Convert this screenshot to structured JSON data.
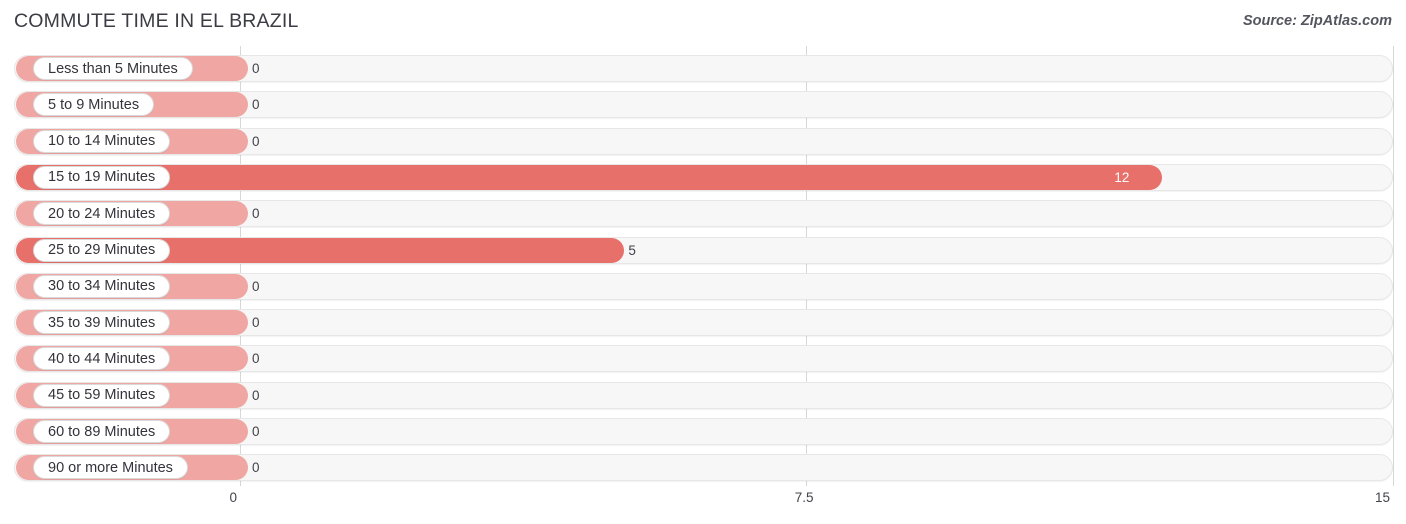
{
  "header": {
    "title": "COMMUTE TIME IN EL BRAZIL",
    "source": "Source: ZipAtlas.com"
  },
  "chart_data": {
    "type": "bar",
    "orientation": "horizontal",
    "title": "COMMUTE TIME IN EL BRAZIL",
    "xlabel": "",
    "ylabel": "",
    "xlim": [
      0,
      15
    ],
    "xticks": [
      "0",
      "7.5",
      "15"
    ],
    "xtick_values": [
      0,
      7.5,
      15
    ],
    "grid": true,
    "legend": "none",
    "categories": [
      "Less than 5 Minutes",
      "5 to 9 Minutes",
      "10 to 14 Minutes",
      "15 to 19 Minutes",
      "20 to 24 Minutes",
      "25 to 29 Minutes",
      "30 to 34 Minutes",
      "35 to 39 Minutes",
      "40 to 44 Minutes",
      "45 to 59 Minutes",
      "60 to 89 Minutes",
      "90 or more Minutes"
    ],
    "values": [
      0,
      0,
      0,
      12,
      0,
      5,
      0,
      0,
      0,
      0,
      0,
      0
    ],
    "value_labels": [
      "0",
      "0",
      "0",
      "12",
      "0",
      "5",
      "0",
      "0",
      "0",
      "0",
      "0",
      "0"
    ],
    "colors": {
      "bar_strong": "#e8706b",
      "bar_faint": "#f0a7a4",
      "track": "#f7f7f7",
      "gridline": "#d8d6d6",
      "text": "#43434b"
    }
  },
  "rows": [
    {
      "label": "Less than 5 Minutes",
      "value": 0,
      "value_label": "0",
      "inside": false
    },
    {
      "label": "5 to 9 Minutes",
      "value": 0,
      "value_label": "0",
      "inside": false
    },
    {
      "label": "10 to 14 Minutes",
      "value": 0,
      "value_label": "0",
      "inside": false
    },
    {
      "label": "15 to 19 Minutes",
      "value": 12,
      "value_label": "12",
      "inside": true
    },
    {
      "label": "20 to 24 Minutes",
      "value": 0,
      "value_label": "0",
      "inside": false
    },
    {
      "label": "25 to 29 Minutes",
      "value": 5,
      "value_label": "5",
      "inside": false
    },
    {
      "label": "30 to 34 Minutes",
      "value": 0,
      "value_label": "0",
      "inside": false
    },
    {
      "label": "35 to 39 Minutes",
      "value": 0,
      "value_label": "0",
      "inside": false
    },
    {
      "label": "40 to 44 Minutes",
      "value": 0,
      "value_label": "0",
      "inside": false
    },
    {
      "label": "45 to 59 Minutes",
      "value": 0,
      "value_label": "0",
      "inside": false
    },
    {
      "label": "60 to 89 Minutes",
      "value": 0,
      "value_label": "0",
      "inside": false
    },
    {
      "label": "90 or more Minutes",
      "value": 0,
      "value_label": "0",
      "inside": false
    }
  ],
  "axis": {
    "ticks": [
      {
        "label": "0",
        "value": 0
      },
      {
        "label": "7.5",
        "value": 7.5
      },
      {
        "label": "15",
        "value": 15
      }
    ]
  }
}
